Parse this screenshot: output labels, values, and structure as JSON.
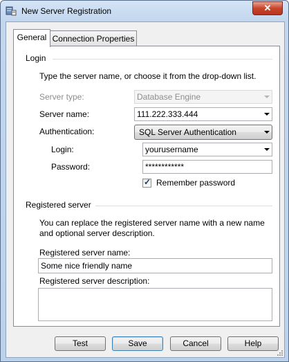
{
  "window": {
    "title": "New Server Registration",
    "close_glyph": "✕"
  },
  "tabs": [
    {
      "label": "General"
    },
    {
      "label": "Connection Properties"
    }
  ],
  "login": {
    "section_title": "Login",
    "instructions": "Type the server name, or choose it from the drop-down list.",
    "server_type_label": "Server type:",
    "server_type_value": "Database Engine",
    "server_name_label": "Server name:",
    "server_name_value": "111.222.333.444",
    "authentication_label": "Authentication:",
    "authentication_value": "SQL Server Authentication",
    "login_label": "Login:",
    "login_value": "yourusername",
    "password_label": "Password:",
    "password_value": "************",
    "remember_label": "Remember password",
    "remember_checked": true
  },
  "registered": {
    "section_title": "Registered server",
    "instructions_line1": "You can replace the registered server name with a new name",
    "instructions_line2": "and optional server description.",
    "name_label": "Registered server name:",
    "name_value": "Some nice friendly name",
    "description_label": "Registered server description:",
    "description_value": ""
  },
  "buttons": {
    "test": "Test",
    "save": "Save",
    "cancel": "Cancel",
    "help": "Help"
  }
}
